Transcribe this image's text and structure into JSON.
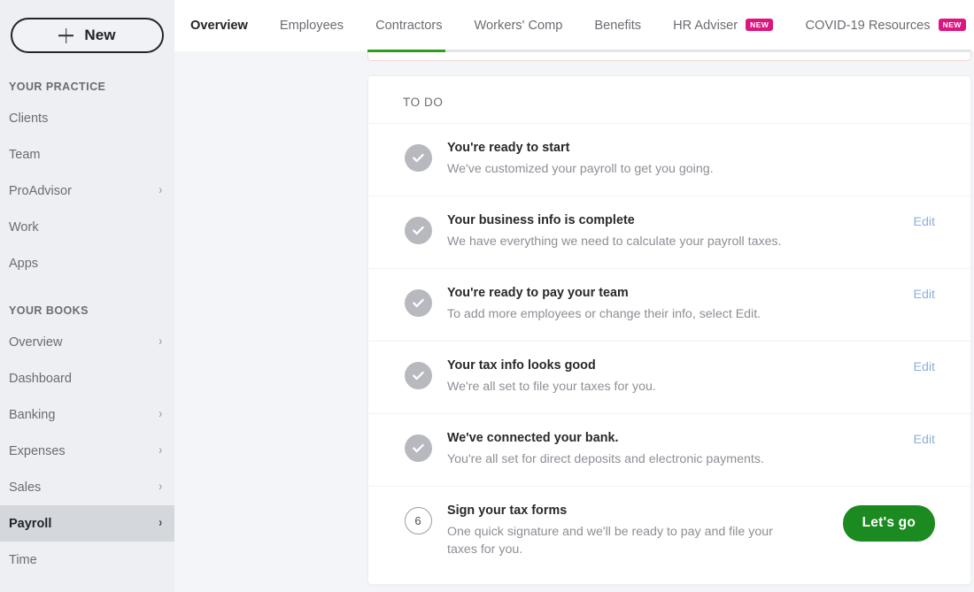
{
  "sidebar": {
    "new_button": {
      "label": "New",
      "icon": "plus-icon"
    },
    "groups": [
      {
        "title": "YOUR PRACTICE",
        "items": [
          {
            "label": "Clients",
            "chevron": false,
            "active": false
          },
          {
            "label": "Team",
            "chevron": false,
            "active": false
          },
          {
            "label": "ProAdvisor",
            "chevron": true,
            "active": false
          },
          {
            "label": "Work",
            "chevron": false,
            "active": false
          },
          {
            "label": "Apps",
            "chevron": false,
            "active": false
          }
        ]
      },
      {
        "title": "YOUR BOOKS",
        "items": [
          {
            "label": "Overview",
            "chevron": true,
            "active": false
          },
          {
            "label": "Dashboard",
            "chevron": false,
            "active": false
          },
          {
            "label": "Banking",
            "chevron": true,
            "active": false
          },
          {
            "label": "Expenses",
            "chevron": true,
            "active": false
          },
          {
            "label": "Sales",
            "chevron": true,
            "active": false
          },
          {
            "label": "Payroll",
            "chevron": true,
            "active": true
          },
          {
            "label": "Time",
            "chevron": false,
            "active": false
          }
        ]
      }
    ],
    "chevron_glyph": "›"
  },
  "tabs": [
    {
      "label": "Overview",
      "active": true,
      "badge": ""
    },
    {
      "label": "Employees",
      "active": false,
      "badge": ""
    },
    {
      "label": "Contractors",
      "active": false,
      "badge": ""
    },
    {
      "label": "Workers' Comp",
      "active": false,
      "badge": ""
    },
    {
      "label": "Benefits",
      "active": false,
      "badge": ""
    },
    {
      "label": "HR Adviser",
      "active": false,
      "badge": "NEW"
    },
    {
      "label": "COVID-19 Resources",
      "active": false,
      "badge": "NEW"
    }
  ],
  "todo": {
    "heading": "TO DO",
    "items": [
      {
        "status": "complete",
        "number": "",
        "title": "You're ready to start",
        "desc": "We've customized your payroll to get you going.",
        "action": "",
        "action_type": "none"
      },
      {
        "status": "complete",
        "number": "",
        "title": "Your business info is complete",
        "desc": "We have everything we need to calculate your payroll taxes.",
        "action": "Edit",
        "action_type": "link"
      },
      {
        "status": "complete",
        "number": "",
        "title": "You're ready to pay your team",
        "desc": "To add more employees or change their info, select Edit.",
        "action": "Edit",
        "action_type": "link"
      },
      {
        "status": "complete",
        "number": "",
        "title": "Your tax info looks good",
        "desc": "We're all set to file your taxes for you.",
        "action": "Edit",
        "action_type": "link"
      },
      {
        "status": "complete",
        "number": "",
        "title": "We've connected your bank.",
        "desc": "You're all set for direct deposits and electronic payments.",
        "action": "Edit",
        "action_type": "link"
      },
      {
        "status": "pending",
        "number": "6",
        "title": "Sign your tax forms",
        "desc": "One quick signature and we'll be ready to pay and file your taxes for you.",
        "action": "Let's go",
        "action_type": "button"
      }
    ]
  },
  "colors": {
    "accent_green": "#2ca01c",
    "cta_green": "#1b8a20",
    "badge_pink": "#dd157f",
    "link_blue": "#8ab0dd",
    "sidebar_bg": "#eeeff2",
    "sidebar_active_bg": "#d4d7dc",
    "page_bg": "#f4f5f8"
  }
}
